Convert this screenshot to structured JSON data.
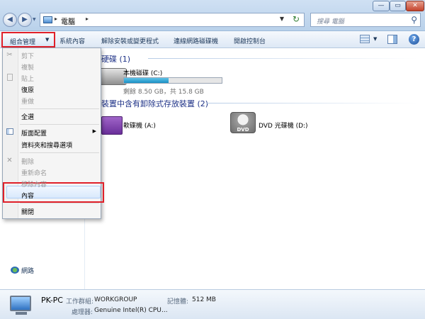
{
  "window": {
    "min_glyph": "—",
    "max_glyph": "▭",
    "close_glyph": "✕"
  },
  "nav": {
    "back_glyph": "◀",
    "forward_glyph": "▶",
    "recent_glyph": "▼"
  },
  "address": {
    "separator": "▸",
    "location": "電腦",
    "dropdown_glyph": "▼",
    "refresh_glyph": "↻"
  },
  "search": {
    "placeholder": "搜尋 電腦",
    "icon": "search-icon",
    "icon_glyph": "⚲"
  },
  "toolbar": {
    "organize_label": "組合管理",
    "organize_arrow": "▼",
    "items": [
      {
        "label": "系統內容"
      },
      {
        "label": "解除安裝或變更程式"
      },
      {
        "label": "連線網路磁碟機"
      },
      {
        "label": "開啟控制台"
      }
    ],
    "view_drop_glyph": "▼",
    "help_glyph": "?"
  },
  "content": {
    "hdd_header": "硬碟 (1)",
    "removable_header": "裝置中含有卸除式存放裝置 (2)",
    "local_disk": {
      "name": "本機磁碟 (C:)",
      "usage_fraction": 0.46,
      "usage_text": "剩餘 8.50 GB，共 15.8 GB"
    },
    "floppy": {
      "name": "軟碟機 (A:)"
    },
    "dvd": {
      "name": "DVD 光碟機 (D:)",
      "badge": "DVD"
    }
  },
  "navpane": {
    "network_label": "網路"
  },
  "menu": {
    "items": [
      {
        "label": "剪下",
        "enabled": false
      },
      {
        "label": "複製",
        "enabled": false
      },
      {
        "label": "貼上",
        "enabled": false
      },
      {
        "label": "復原",
        "enabled": true
      },
      {
        "label": "重做",
        "enabled": false
      },
      {
        "label": "全選",
        "enabled": true
      },
      {
        "label": "版面配置",
        "enabled": true,
        "submenu_glyph": "▶"
      },
      {
        "label": "資料夾和搜尋選項",
        "enabled": true
      },
      {
        "label": "刪除",
        "enabled": false
      },
      {
        "label": "重新命名",
        "enabled": false
      },
      {
        "label": "移除內容",
        "enabled": false
      },
      {
        "label": "內容",
        "enabled": true
      },
      {
        "label": "關閉",
        "enabled": true
      }
    ],
    "cut_glyph": "✂",
    "delete_glyph": "✕"
  },
  "details": {
    "pc_name": "PK-PC",
    "workgroup_label": "工作群組:",
    "workgroup_value": "WORKGROUP",
    "memory_label": "記憶體:",
    "memory_value": "512 MB",
    "cpu_label": "處理器:",
    "cpu_value": "Genuine Intel(R) CPU",
    "cpu_more": "..."
  },
  "colors": {
    "highlight_border": "#e0202a",
    "usage_fill": "#1a8fc4",
    "group_header": "#1e3287"
  }
}
